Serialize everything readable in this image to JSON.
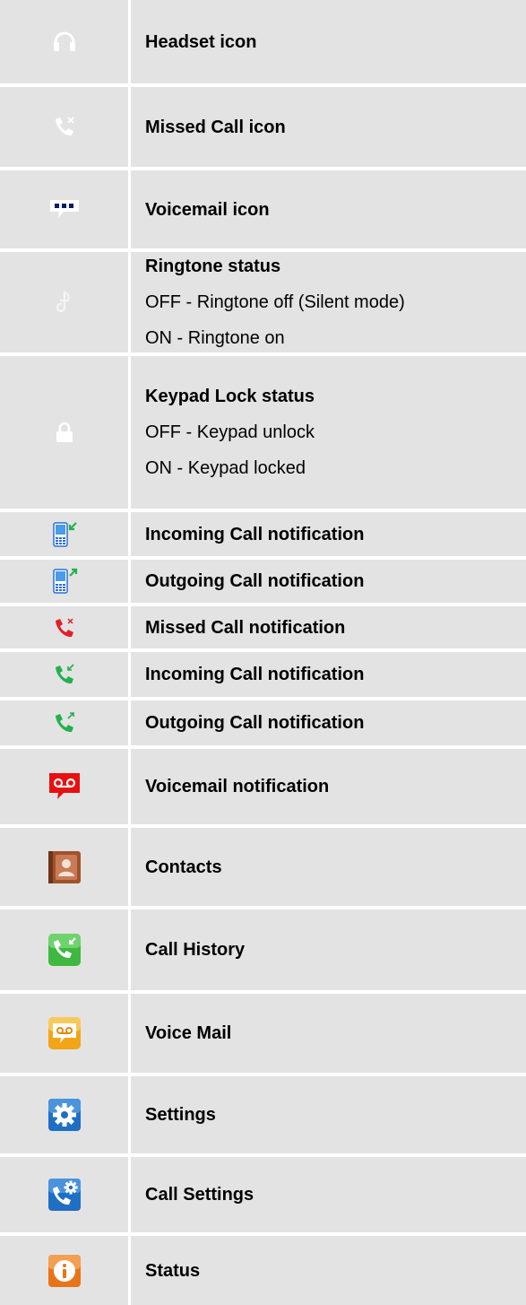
{
  "rows": [
    {
      "icon": "headset-icon",
      "title": "Headset icon"
    },
    {
      "icon": "missed-call-icon",
      "title": "Missed Call icon"
    },
    {
      "icon": "voicemail-icon",
      "title": "Voicemail icon"
    },
    {
      "icon": "ringtone-icon",
      "title": "Ringtone status",
      "lines": [
        "OFF - Ringtone off (Silent mode)",
        "ON - Ringtone on"
      ]
    },
    {
      "icon": "lock-icon",
      "title": "Keypad Lock status",
      "lines": [
        "OFF - Keypad unlock",
        "ON - Keypad locked"
      ]
    },
    {
      "icon": "phone-incoming-icon",
      "title": "Incoming Call notification"
    },
    {
      "icon": "phone-outgoing-icon",
      "title": "Outgoing Call notification"
    },
    {
      "icon": "missed-call-red-icon",
      "title": "Missed Call notification"
    },
    {
      "icon": "incoming-call-green-icon",
      "title": "Incoming Call notification"
    },
    {
      "icon": "outgoing-call-green-icon",
      "title": "Outgoing Call notification"
    },
    {
      "icon": "voicemail-red-icon",
      "title": "Voicemail notification"
    },
    {
      "icon": "contacts-icon",
      "title": "Contacts"
    },
    {
      "icon": "call-history-icon",
      "title": "Call History"
    },
    {
      "icon": "voice-mail-app-icon",
      "title": "Voice Mail"
    },
    {
      "icon": "settings-icon",
      "title": "Settings"
    },
    {
      "icon": "call-settings-icon",
      "title": "Call Settings"
    },
    {
      "icon": "status-icon",
      "title": "Status"
    }
  ],
  "colors": {
    "row_bg": "#e3e3e3",
    "missed_red": "#e0202a",
    "call_green": "#22b14c",
    "voicemail_red": "#e81010",
    "contacts_brown": "#a0522d",
    "history_green": "#3fb83f",
    "voice_mail_orange": "#f2a516",
    "settings_blue": "#1f6fc4",
    "status_orange": "#e8741a"
  }
}
